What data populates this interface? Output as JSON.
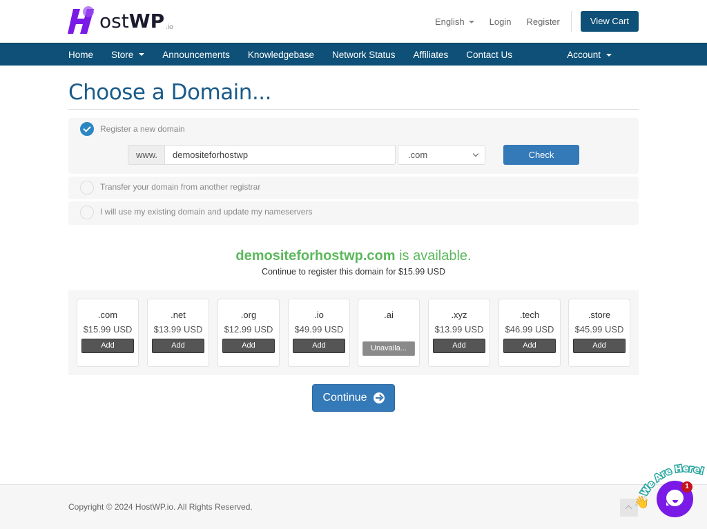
{
  "brand": {
    "name_part1": "ost",
    "name_part2": "WP",
    "suffix": ".io",
    "accent": "#7a1ae6"
  },
  "header": {
    "language": "English",
    "login": "Login",
    "register": "Register",
    "view_cart": "View Cart"
  },
  "nav": {
    "items": [
      {
        "label": "Home",
        "dropdown": false
      },
      {
        "label": "Store",
        "dropdown": true
      },
      {
        "label": "Announcements",
        "dropdown": false
      },
      {
        "label": "Knowledgebase",
        "dropdown": false
      },
      {
        "label": "Network Status",
        "dropdown": false
      },
      {
        "label": "Affiliates",
        "dropdown": false
      },
      {
        "label": "Contact Us",
        "dropdown": false
      }
    ],
    "account": "Account"
  },
  "main": {
    "title": "Choose a Domain...",
    "options": [
      {
        "label": "Register a new domain",
        "checked": true
      },
      {
        "label": "Transfer your domain from another registrar",
        "checked": false
      },
      {
        "label": "I will use my existing domain and update my nameservers",
        "checked": false
      }
    ],
    "www_prefix": "www.",
    "domain_value": "demositeforhostwp",
    "tld_selected": ".com",
    "check_label": "Check",
    "availability": {
      "domain": "demositeforhostwp.com",
      "status_text": " is available.",
      "subtext": "Continue to register this domain for $15.99 USD"
    },
    "suggestions": [
      {
        "tld": ".com",
        "price": "$15.99 USD",
        "button": "Add",
        "available": true
      },
      {
        "tld": ".net",
        "price": "$13.99 USD",
        "button": "Add",
        "available": true
      },
      {
        "tld": ".org",
        "price": "$12.99 USD",
        "button": "Add",
        "available": true
      },
      {
        "tld": ".io",
        "price": "$49.99 USD",
        "button": "Add",
        "available": true
      },
      {
        "tld": ".ai",
        "price": "",
        "button": "Unavaila...",
        "available": false
      },
      {
        "tld": ".xyz",
        "price": "$13.99 USD",
        "button": "Add",
        "available": true
      },
      {
        "tld": ".tech",
        "price": "$46.99 USD",
        "button": "Add",
        "available": true
      },
      {
        "tld": ".store",
        "price": "$45.99 USD",
        "button": "Add",
        "available": true
      }
    ],
    "continue_label": "Continue"
  },
  "footer": {
    "copyright": "Copyright © 2024 HostWP.io. All Rights Reserved."
  },
  "chat": {
    "badge_count": "1",
    "tagline": "We Are Here!"
  }
}
